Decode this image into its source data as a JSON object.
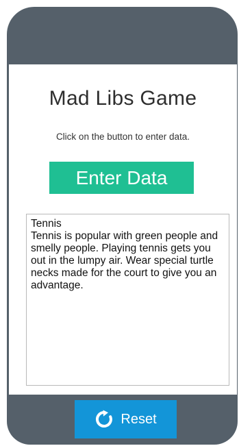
{
  "app": {
    "title": "Mad Libs Game",
    "instructions": "Click on the button to enter data.",
    "enter_button_label": "Enter Data",
    "reset_button_label": "Reset",
    "reset_icon": "reset-icon"
  },
  "story": {
    "title": "Tennis",
    "body": "Tennis is popular with green people and smelly people. Playing tennis gets you out in the lumpy air. Wear special turtle necks made for the court to give you an advantage."
  },
  "colors": {
    "frame": "#55606a",
    "enter_button": "#1fbf93",
    "reset_button": "#1395d8"
  }
}
